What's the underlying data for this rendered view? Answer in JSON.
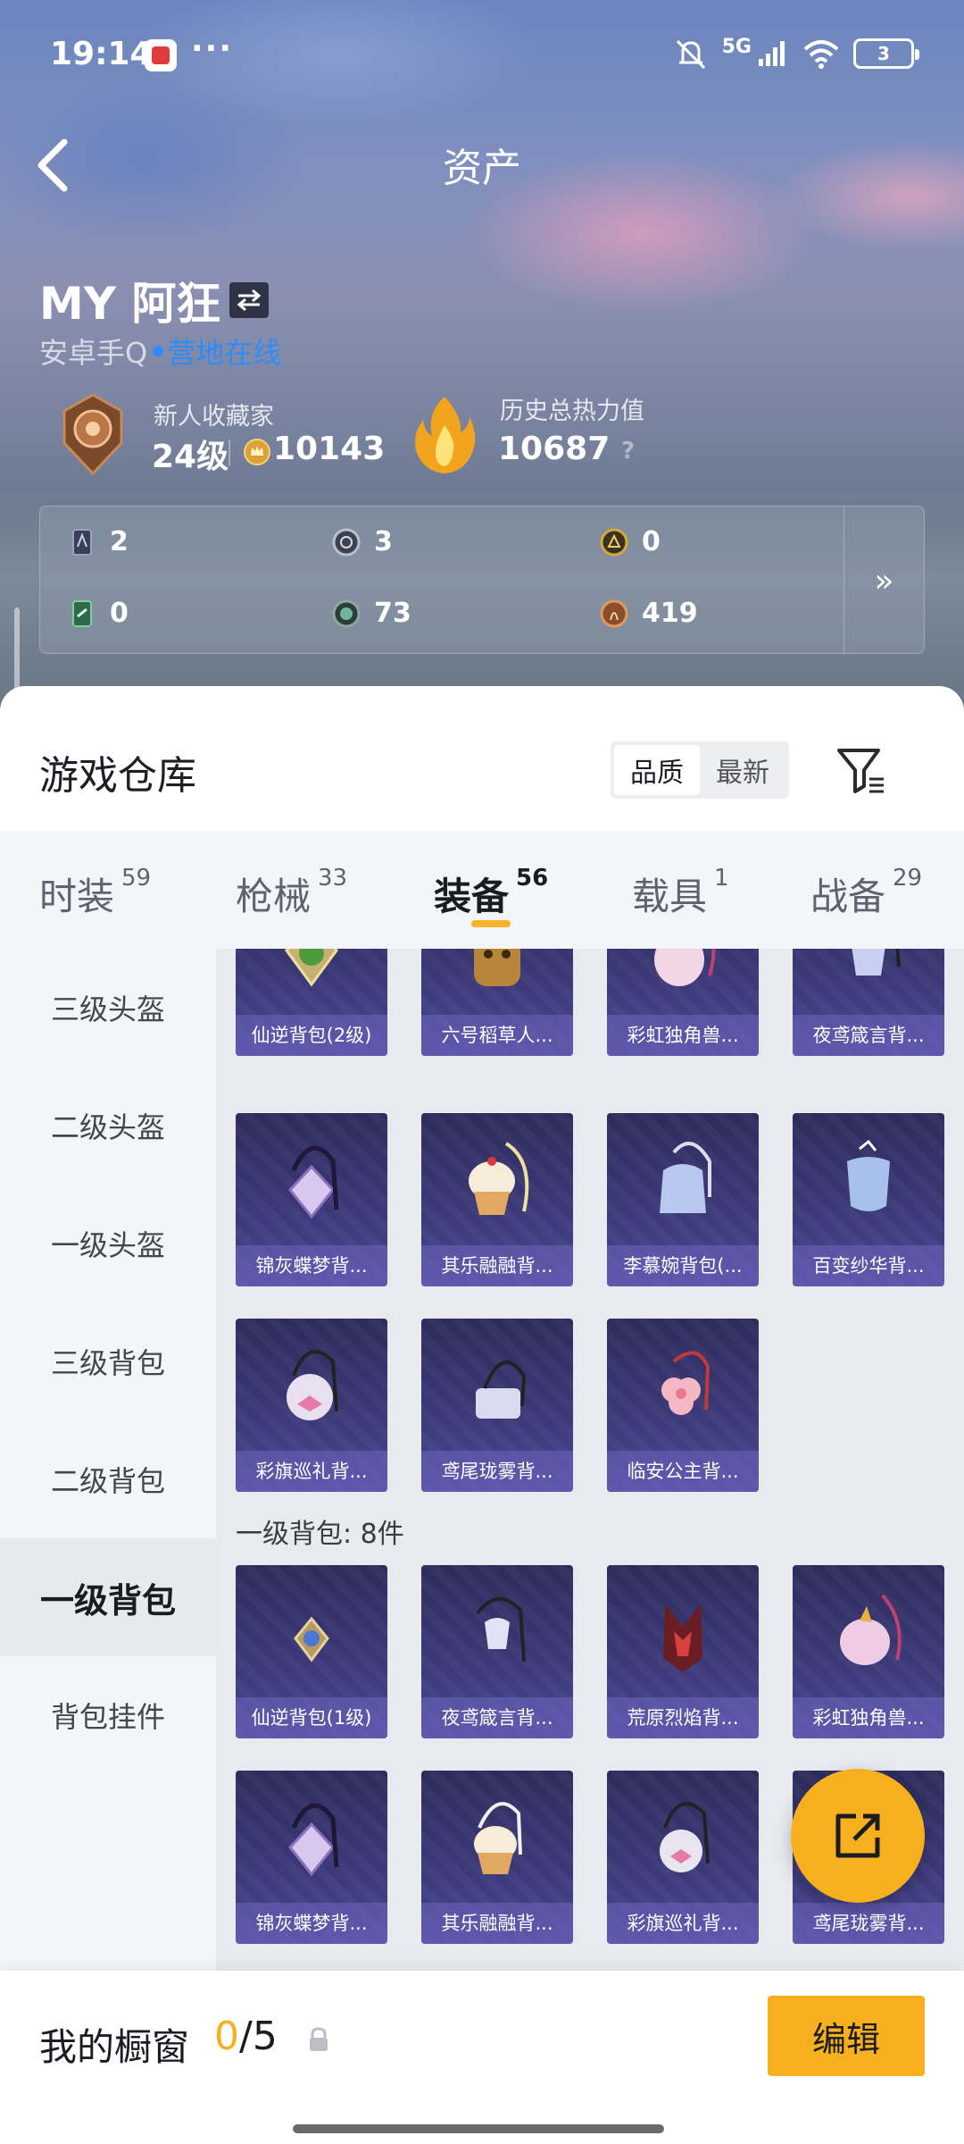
{
  "status_bar": {
    "time": "19:14",
    "more": "···",
    "network": "5G",
    "battery": "3"
  },
  "header": {
    "title": "资产"
  },
  "profile": {
    "name": "MY 阿狂",
    "platform": "安卓手Q",
    "online_status": "营地在线",
    "collector_title": "新人收藏家",
    "collector_level": "24级",
    "coin_value": "10143",
    "heat_label": "历史总热力值",
    "heat_value": "10687",
    "help": "?"
  },
  "currencies": [
    {
      "icon": "dark-card-icon",
      "value": "2"
    },
    {
      "icon": "silver-token-icon",
      "value": "3"
    },
    {
      "icon": "gold-token-icon",
      "value": "0"
    },
    {
      "icon": "green-card-icon",
      "value": "0"
    },
    {
      "icon": "green-orb-icon",
      "value": "73"
    },
    {
      "icon": "bronze-coin-icon",
      "value": "419"
    }
  ],
  "currency_more": "»",
  "warehouse": {
    "title": "游戏仓库",
    "sort_options": [
      "品质",
      "最新"
    ],
    "active_sort": "品质"
  },
  "tabs": [
    {
      "label": "时装",
      "count": "59"
    },
    {
      "label": "枪械",
      "count": "33"
    },
    {
      "label": "装备",
      "count": "56"
    },
    {
      "label": "载具",
      "count": "1"
    },
    {
      "label": "战备",
      "count": "29"
    }
  ],
  "active_tab": "装备",
  "categories": [
    "三级头盔",
    "二级头盔",
    "一级头盔",
    "三级背包",
    "二级背包",
    "一级背包",
    "背包挂件"
  ],
  "active_category": "一级背包",
  "items_top": [
    "仙逆背包(2级)",
    "六号稻草人...",
    "彩虹独角兽...",
    "夜鸢箴言背...",
    "锦灰蝶梦背...",
    "其乐融融背...",
    "李慕婉背包(...",
    "百变纱华背...",
    "彩旗巡礼背...",
    "鸢尾珑雾背...",
    "临安公主背..."
  ],
  "section_label": "一级背包: 8件",
  "items_bottom": [
    "仙逆背包(1级)",
    "夜鸢箴言背...",
    "荒原烈焰背...",
    "彩虹独角兽...",
    "锦灰蝶梦背...",
    "其乐融融背...",
    "彩旗巡礼背...",
    "鸢尾珑雾背..."
  ],
  "showcase": {
    "label": "我的橱窗",
    "current": "0",
    "separator": "/",
    "max": "5",
    "edit_label": "编辑"
  },
  "colors": {
    "accent": "#f6b01e",
    "link_blue": "#2c8cf8",
    "card_purple": "#3c3a7a"
  }
}
